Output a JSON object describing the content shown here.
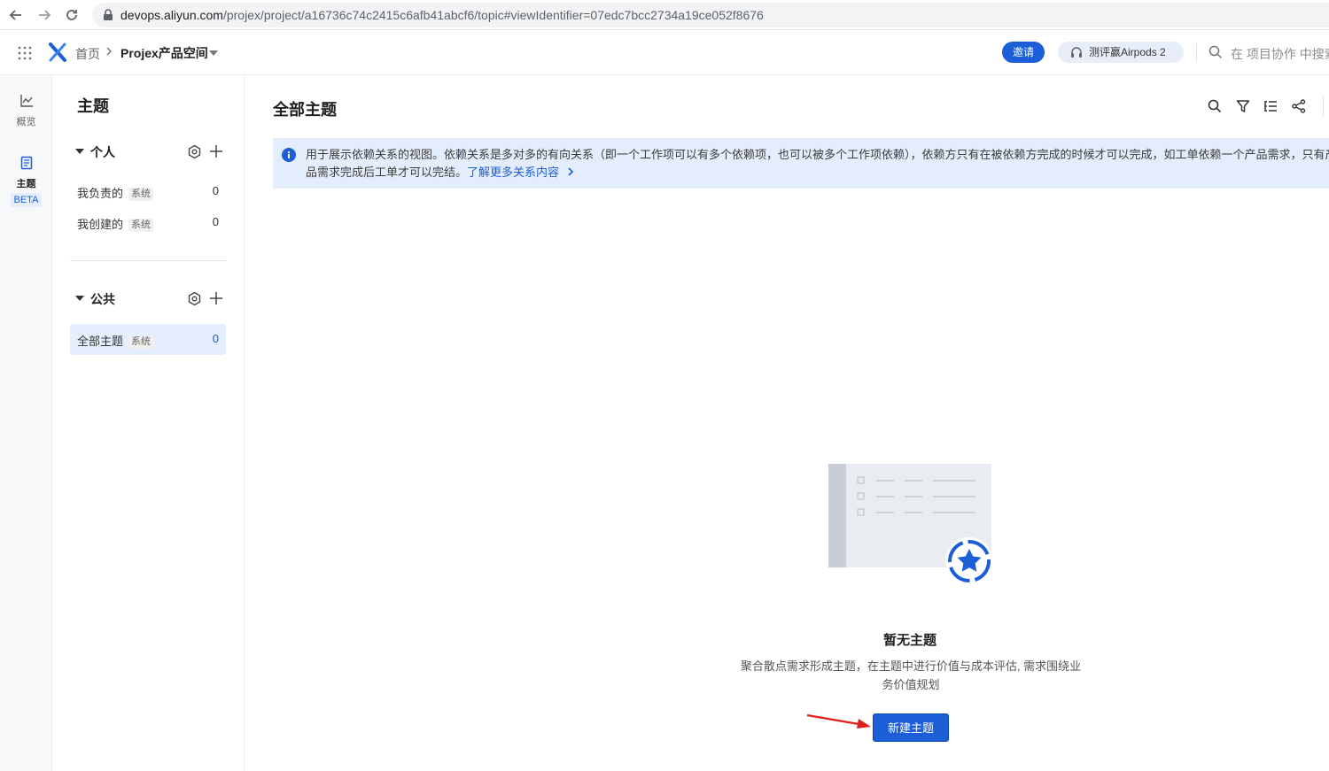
{
  "browser": {
    "url_host": "devops.aliyun.com",
    "url_path": "/projex/project/a16736c74c2415c6afb41abcf6/topic#viewIdentifier=07edc7bcc2734a19ce052f8676"
  },
  "header": {
    "breadcrumb_home": "首页",
    "breadcrumb_project": "Projex产品空间",
    "invite_label": "邀请",
    "promo_label": "测评赢Airpods 2",
    "search_placeholder": "在 项目协作 中搜索"
  },
  "rail": {
    "items": [
      {
        "label": "概览",
        "icon": "chart-line-icon"
      },
      {
        "label": "主题",
        "icon": "document-icon",
        "badge": "BETA"
      }
    ]
  },
  "sidebar": {
    "title": "主题",
    "groups": [
      {
        "name": "个人",
        "items": [
          {
            "name": "我负责的",
            "tag": "系统",
            "count": "0"
          },
          {
            "name": "我创建的",
            "tag": "系统",
            "count": "0"
          }
        ]
      },
      {
        "name": "公共",
        "items": [
          {
            "name": "全部主题",
            "tag": "系统",
            "count": "0"
          }
        ]
      }
    ]
  },
  "main": {
    "title": "全部主题",
    "banner_text": "用于展示依赖关系的视图。依赖关系是多对多的有向关系（即一个工作项可以有多个依赖项，也可以被多个工作项依赖），依赖方只有在被依赖方完成的时候才可以完成，如工单依赖一个产品需求，只有产品需求完成后工单才可以完结。",
    "banner_link": "了解更多关系内容",
    "empty_title": "暂无主题",
    "empty_desc": "聚合散点需求形成主题，在主题中进行价值与成本评估, 需求围绕业务价值规划",
    "new_button": "新建主题"
  },
  "colors": {
    "accent": "#1b5ed8",
    "banner_bg": "#e3edfc",
    "selected_bg": "#e5eefc",
    "annotation_arrow": "#e0201b"
  }
}
